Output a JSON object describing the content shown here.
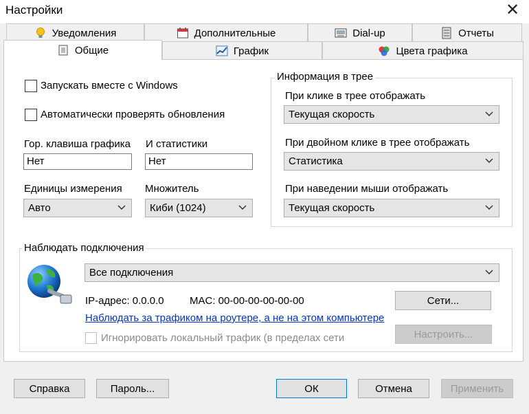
{
  "window": {
    "title": "Настройки"
  },
  "tabs_row1": [
    {
      "label": "Уведомления",
      "icon": "lightbulb-icon"
    },
    {
      "label": "Дополнительные",
      "icon": "calendar-icon"
    },
    {
      "label": "Dial-up",
      "icon": "dialup-icon"
    },
    {
      "label": "Отчеты",
      "icon": "server-icon"
    }
  ],
  "tabs_row2": [
    {
      "label": "Общие",
      "icon": "general-icon",
      "active": true
    },
    {
      "label": "График",
      "icon": "graph-icon"
    },
    {
      "label": "Цвета графика",
      "icon": "colors-icon"
    }
  ],
  "general": {
    "start_with_windows": {
      "label": "Запускать вместе с Windows",
      "checked": false
    },
    "auto_update": {
      "label": "Автоматически проверять обновления",
      "checked": false
    },
    "hotkey_graph": {
      "label": "Гор. клавиша графика",
      "value": "Нет"
    },
    "hotkey_stats": {
      "label": "И статистики",
      "value": "Нет"
    },
    "units": {
      "label": "Единицы измерения",
      "value": "Авто"
    },
    "multiplier": {
      "label": "Множитель",
      "value": "Киби (1024)"
    }
  },
  "tray_info": {
    "legend": "Информация в трее",
    "click": {
      "label": "При клике в трее отображать",
      "value": "Текущая скорость"
    },
    "double_click": {
      "label": "При двойном клике в трее отображать",
      "value": "Статистика"
    },
    "hover": {
      "label": "При наведении мыши отображать",
      "value": "Текущая скорость"
    }
  },
  "monitor": {
    "legend": "Наблюдать подключения",
    "connection": "Все подключения",
    "ip": "IP-адрес: 0.0.0.0",
    "mac": "MAC: 00-00-00-00-00-00",
    "networks_button": "Сети...",
    "router_link": "Наблюдать за трафиком на роутере, а не на этом компьютере",
    "ignore_local": {
      "label": "Игнорировать локальный трафик (в пределах сети",
      "checked": false,
      "disabled": true
    },
    "configure_button": "Настроить..."
  },
  "footer": {
    "help": "Справка",
    "password": "Пароль...",
    "ok": "ОК",
    "cancel": "Отмена",
    "apply": "Применить"
  },
  "colors": {
    "link": "#0033cc",
    "focus_border": "#0078d7",
    "disabled_text": "#9a9a9a"
  }
}
